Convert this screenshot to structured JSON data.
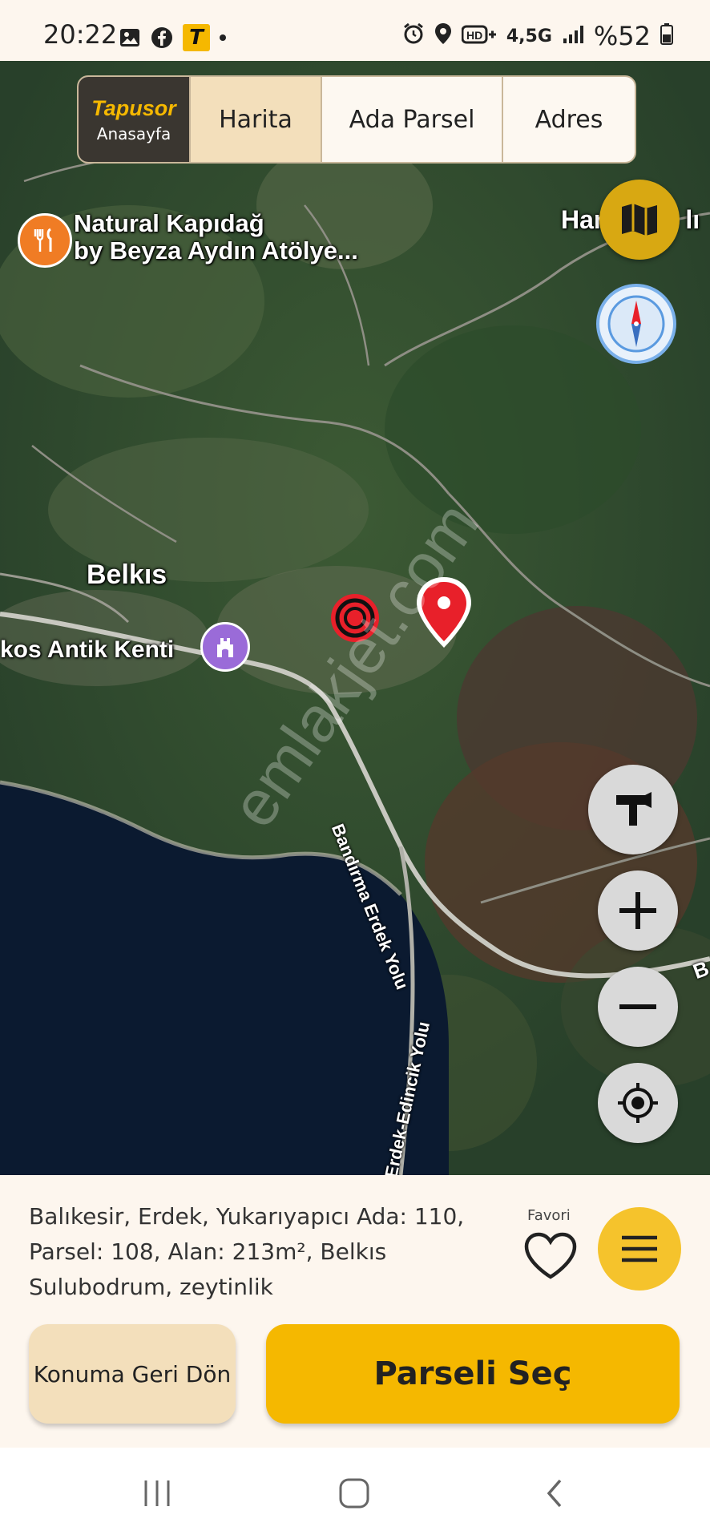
{
  "status_bar": {
    "time": "20:22",
    "left_icons": [
      "image-icon",
      "facebook-icon",
      "tapusor-icon",
      "dot-icon"
    ],
    "network": "4,5G",
    "battery": "%52",
    "right_icons": [
      "alarm-icon",
      "location-icon",
      "hd-plus-icon",
      "network-icon",
      "signal-icon",
      "battery-icon"
    ]
  },
  "topnav": {
    "brand": "Tapusor",
    "brand_sub": "Anasayfa",
    "tabs": [
      "Harita",
      "Ada Parsel",
      "Adres"
    ],
    "active_tab": "Harita",
    "active_color": "#f3dfbb"
  },
  "map": {
    "labels": {
      "poi1": "Natural Kapıdağ",
      "poi1_line2": "by Beyza Aydın Atölye...",
      "place_belkis": "Belkıs",
      "place_antik": "kos Antik Kenti",
      "place_top_right": "Ham",
      "place_top_right_end": "lı",
      "road1": "Bandırma Erdek Yolu",
      "road2": "Erdek-Edincik Yolu",
      "road_right": "B"
    },
    "watermark": "emlakjet.com",
    "icons": [
      "restaurant-icon",
      "landmark-icon",
      "target-marker-icon",
      "location-pin-icon"
    ],
    "pin_color": "#e8202a"
  },
  "map_controls": [
    "map-layers-icon",
    "compass-icon",
    "hammer-icon",
    "zoom-in-icon",
    "zoom-out-icon",
    "my-location-icon"
  ],
  "parcel": {
    "line1": "Balıkesir, Erdek, Yukarıyapıcı Ada: 110,",
    "line2": "Parsel: 108, Alan: 213m², Belkıs",
    "line3": "Sulubodrum, zeytinlik"
  },
  "favorite_label": "Favori",
  "buttons": {
    "back": "Konuma Geri Dön",
    "select": "Parseli Seç"
  },
  "colors": {
    "accent": "#f5b800",
    "brand_dark": "#3a3630",
    "sea": "#0b1a30"
  }
}
